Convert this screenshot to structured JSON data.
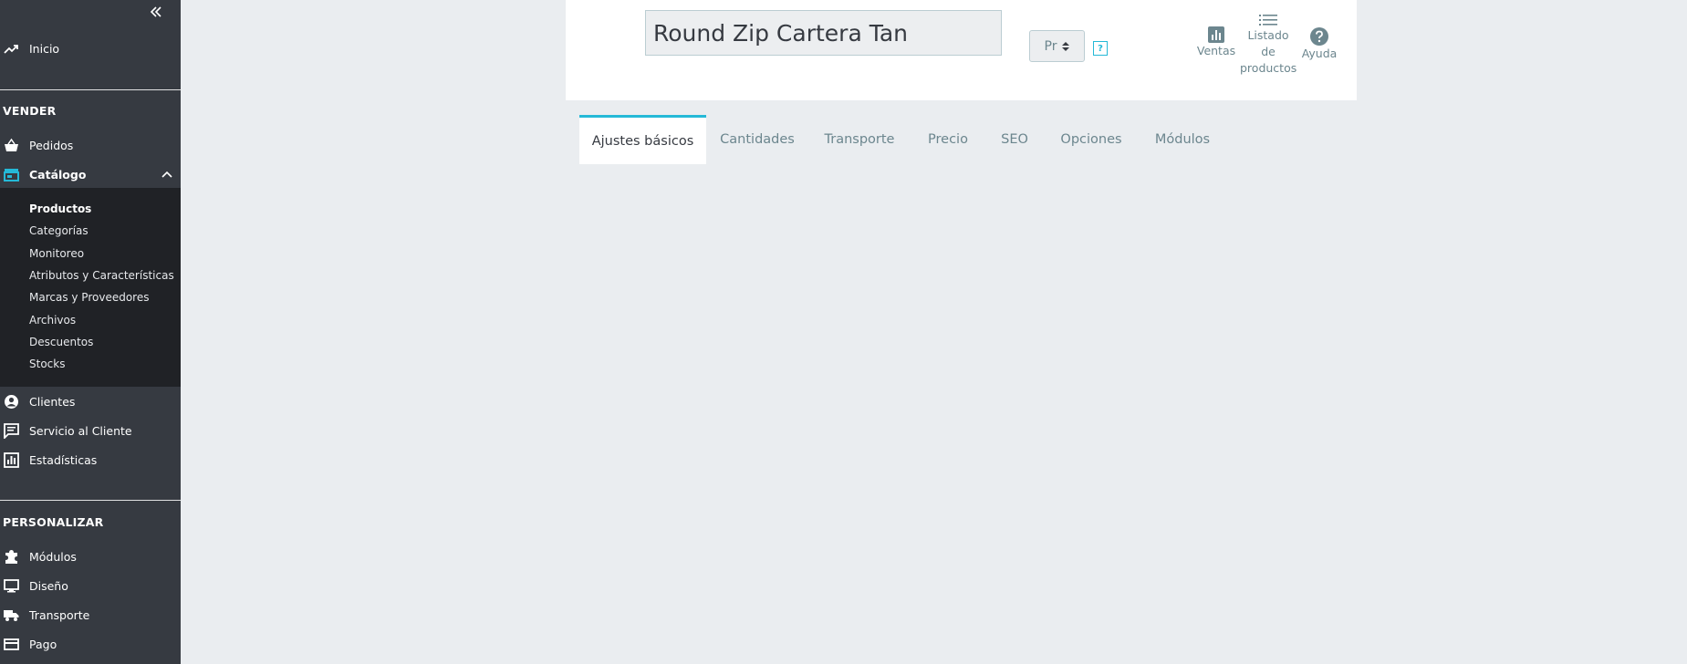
{
  "sidebar": {
    "collapse_icon": "double-chevron-left-icon",
    "dashboard": {
      "label": "Inicio",
      "icon": "trending-up-icon"
    },
    "section_sell": "VENDER",
    "orders": {
      "label": "Pedidos",
      "icon": "basket-icon"
    },
    "catalog": {
      "label": "Catálogo",
      "icon": "store-icon",
      "accent": "#25b9d7"
    },
    "catalog_sub": [
      "Productos",
      "Categorías",
      "Monitoreo",
      "Atributos y Características",
      "Marcas y Proveedores",
      "Archivos",
      "Descuentos",
      "Stocks"
    ],
    "customers": {
      "label": "Clientes",
      "icon": "account-circle-icon"
    },
    "customer_service": {
      "label": "Servicio al Cliente",
      "icon": "chat-icon"
    },
    "stats": {
      "label": "Estadísticas",
      "icon": "bar-chart-icon"
    },
    "section_customize": "PERSONALIZAR",
    "modules": {
      "label": "Módulos",
      "icon": "puzzle-icon"
    },
    "design": {
      "label": "Diseño",
      "icon": "desktop-icon"
    },
    "shipping": {
      "label": "Transporte",
      "icon": "truck-icon"
    },
    "payment": {
      "label": "Pago",
      "icon": "credit-card-icon"
    }
  },
  "header": {
    "product_name": "Round Zip Cartera Tan",
    "language_select": "Pr",
    "help_mark": "?",
    "toolbar": {
      "sales": "Ventas",
      "product_list_line1": "Listado",
      "product_list_line2": "de",
      "product_list_line3": "productos",
      "help": "Ayuda"
    }
  },
  "tabs": [
    "Ajustes básicos",
    "Cantidades",
    "Transporte",
    "Precio",
    "SEO",
    "Opciones",
    "Módulos"
  ],
  "colors": {
    "sidebar": "#363a41",
    "submenu": "#202226",
    "accent": "#25b9d7",
    "muted_text": "#6c868e",
    "page_bg": "#eaedf0"
  }
}
